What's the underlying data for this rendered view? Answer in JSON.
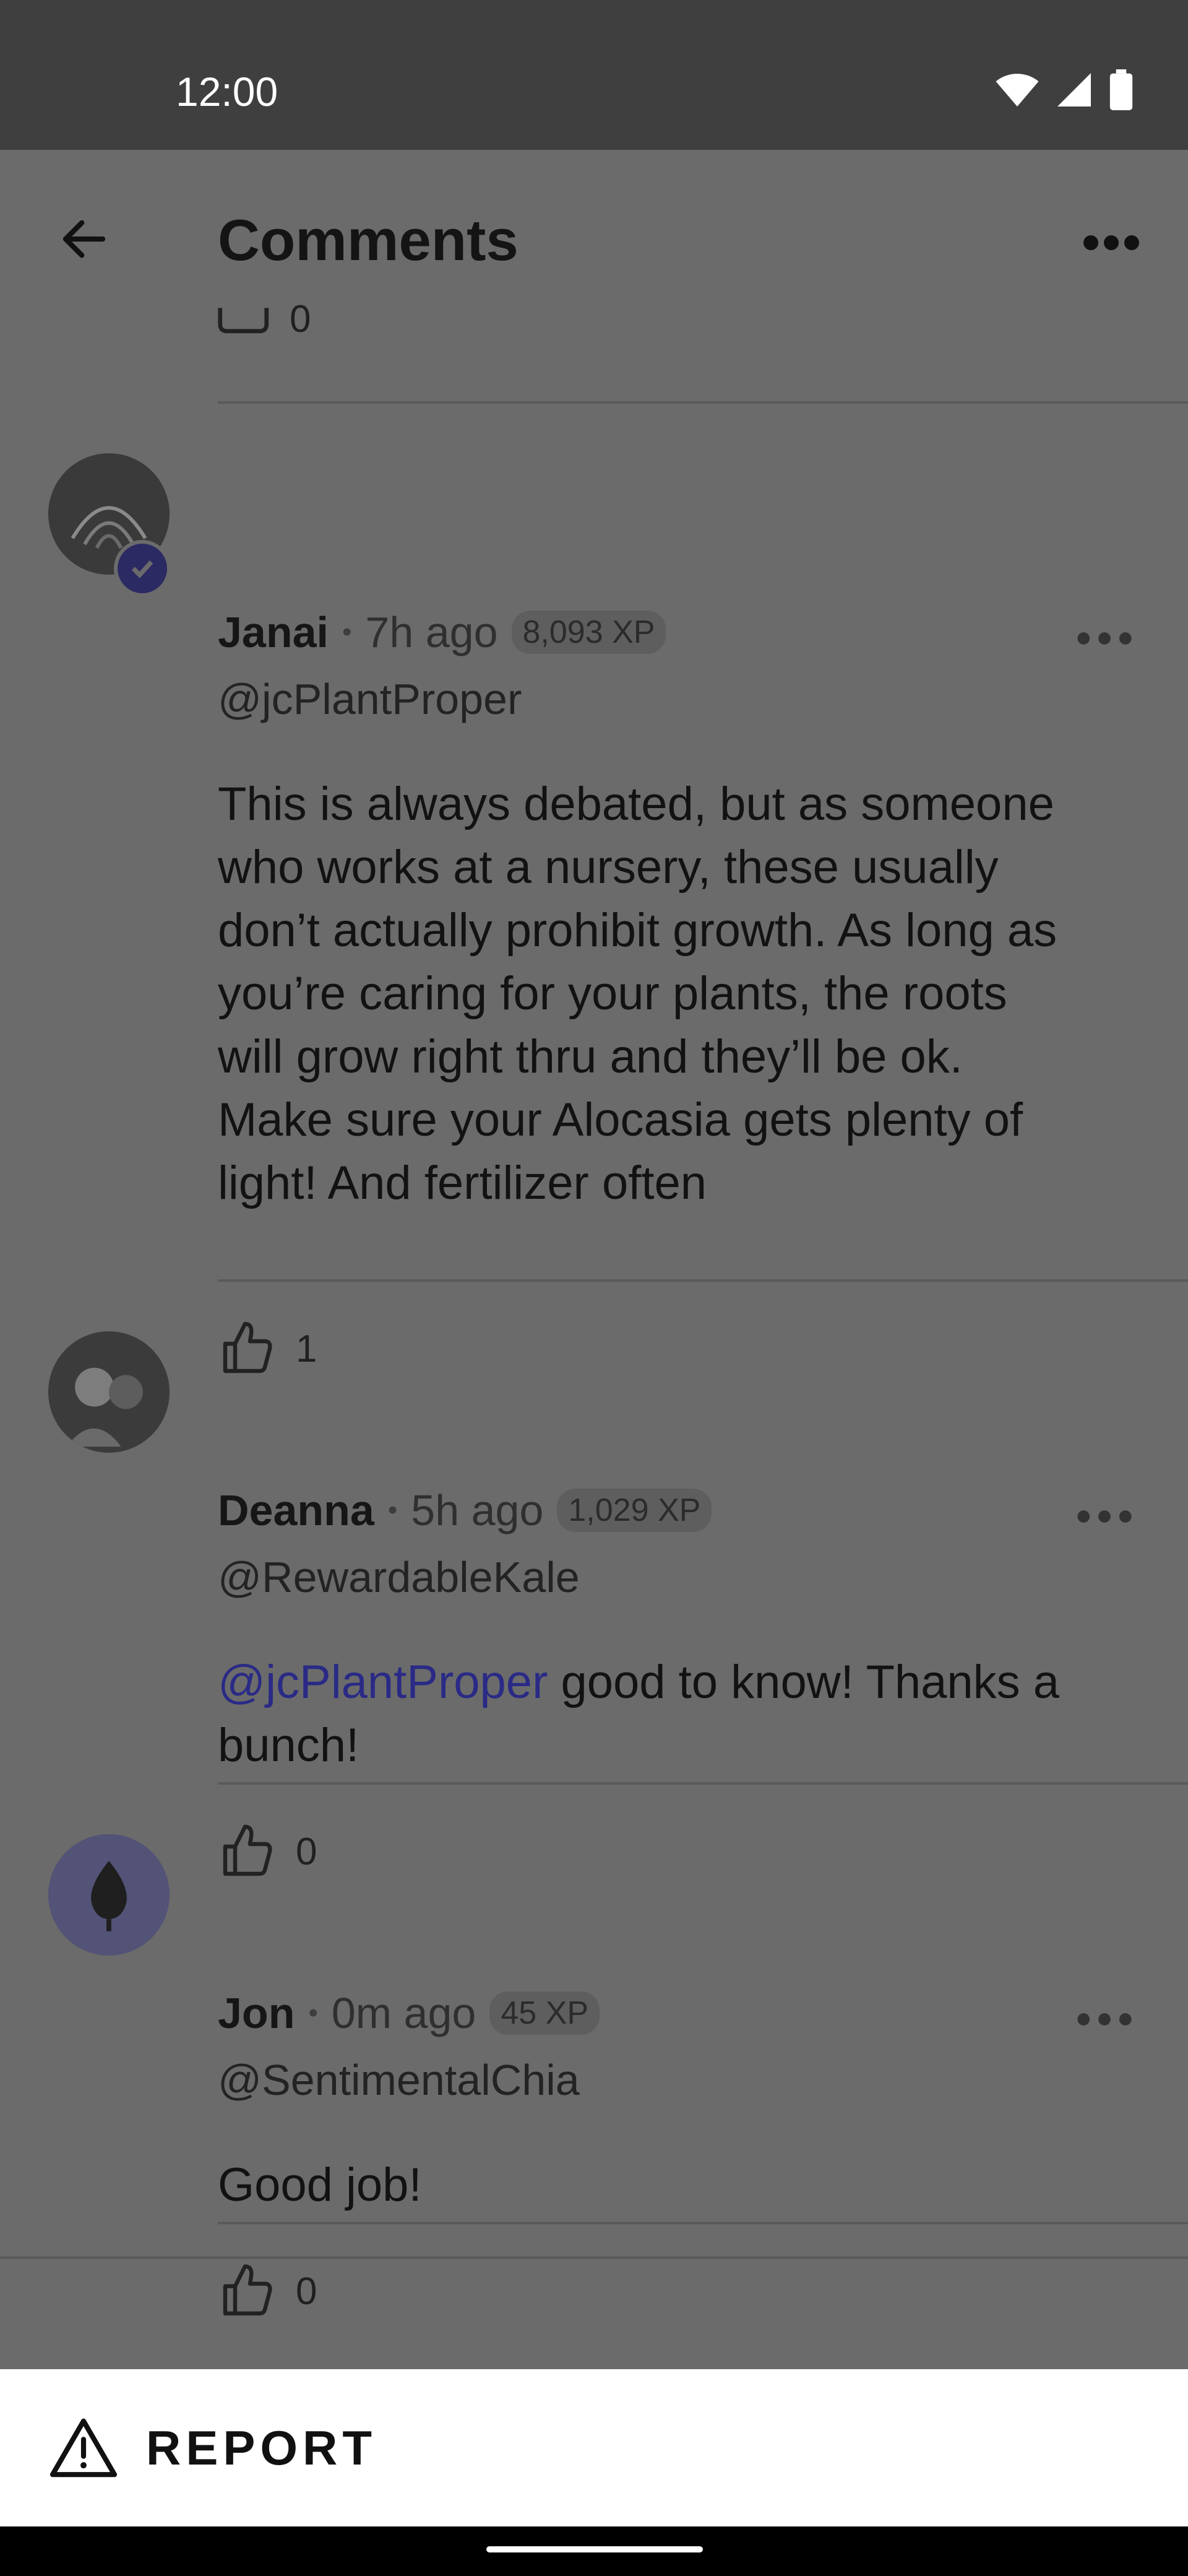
{
  "status_bar": {
    "time": "12:00",
    "icons": [
      "wifi-icon",
      "signal-icon",
      "battery-icon"
    ]
  },
  "header": {
    "title": "Comments",
    "back_icon": "arrow-left-icon",
    "more_icon": "more-horizontal-icon"
  },
  "partial_comment": {
    "like_count": "0"
  },
  "comments": [
    {
      "name": "Janai",
      "time": "7h ago",
      "xp": "8,093 XP",
      "handle": "@jcPlantProper",
      "verified": true,
      "text": "This is always debated, but as someone who works at a nursery, these usually don’t actually prohibit growth. As long as you’re caring for your plants, the roots will grow right thru and they’ll be ok. Make sure your Alocasia gets plenty of light! And fertilizer often",
      "likes": "1"
    },
    {
      "name": "Deanna",
      "time": "5h ago",
      "xp": "1,029 XP",
      "handle": "@RewardableKale",
      "mention": "@jcPlantProper",
      "text": " good to know! Thanks a bunch!",
      "likes": "0"
    },
    {
      "name": "Jon",
      "time": "0m ago",
      "xp": "45 XP",
      "handle": "@SentimentalChia",
      "text": "Good job!",
      "likes": "0"
    }
  ],
  "bottom_sheet": {
    "report_label": "REPORT",
    "icon": "warning-triangle-icon"
  },
  "colors": {
    "overlay": "#6b6b6b",
    "mention": "#2a2a86",
    "sheet": "#ffffff",
    "status_bar": "#3f3f3f"
  }
}
